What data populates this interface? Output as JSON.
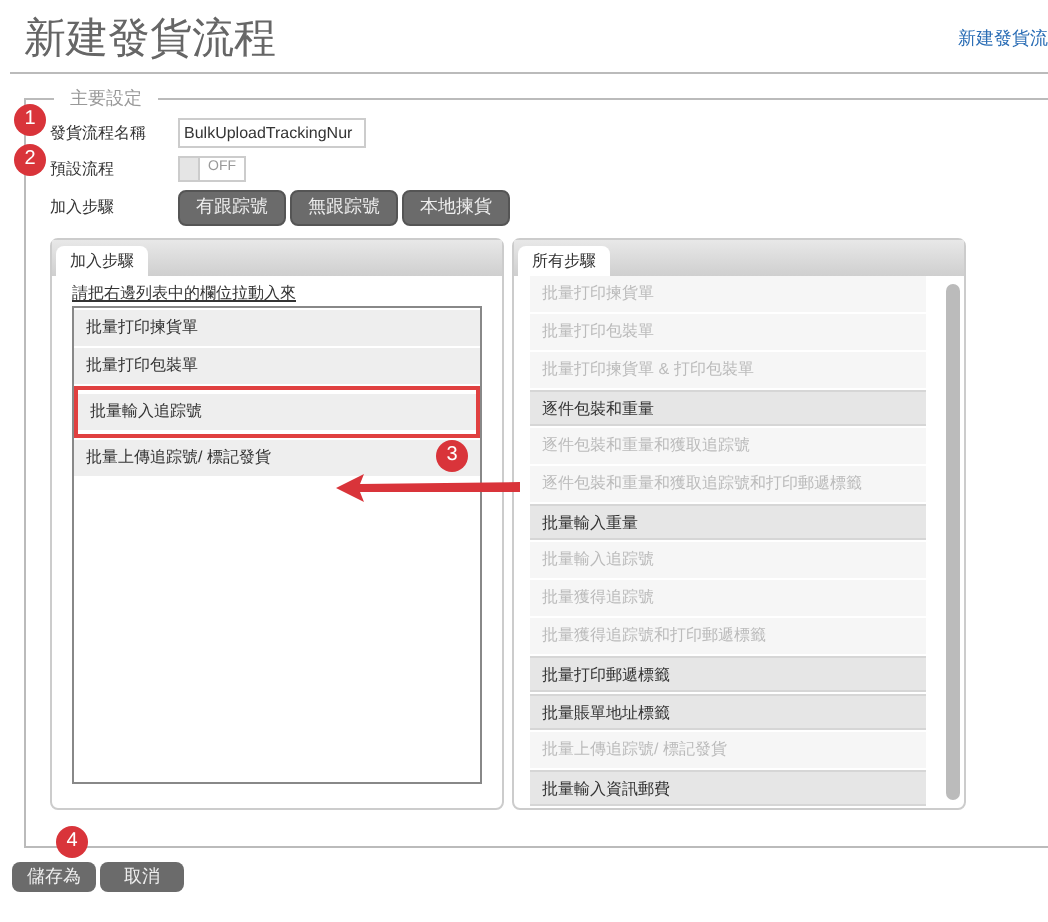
{
  "page": {
    "title": "新建發貨流程",
    "link": "新建發貨流"
  },
  "fieldset": {
    "legend": "主要設定"
  },
  "form": {
    "name_label": "發貨流程名稱",
    "name_value": "BulkUploadTrackingNur",
    "default_label": "預設流程",
    "default_switch": {
      "on": false,
      "label": "OFF"
    },
    "steps_label": "加入步驟",
    "step_buttons": [
      "有跟踪號",
      "無跟踪號",
      "本地揀貨"
    ]
  },
  "added_panel": {
    "tab": "加入步驟",
    "hint": "請把右邊列表中的欄位拉動入來",
    "items": [
      {
        "label": "批量打印揀貨單",
        "highlighted": false
      },
      {
        "label": "批量打印包裝單",
        "highlighted": false
      },
      {
        "label": "批量輸入追踪號",
        "highlighted": true
      },
      {
        "label": "批量上傳追踪號/ 標記發貨",
        "highlighted": false
      }
    ]
  },
  "all_panel": {
    "tab": "所有步驟",
    "items": [
      {
        "label": "批量打印揀貨單",
        "disabled": true
      },
      {
        "label": "批量打印包裝單",
        "disabled": true
      },
      {
        "label": "批量打印揀貨單 & 打印包裝單",
        "disabled": true
      },
      {
        "label": "逐件包裝和重量",
        "disabled": false
      },
      {
        "label": "逐件包裝和重量和獲取追踪號",
        "disabled": true
      },
      {
        "label": "逐件包裝和重量和獲取追踪號和打印郵遞標籤",
        "disabled": true
      },
      {
        "label": "批量輸入重量",
        "disabled": false
      },
      {
        "label": "批量輸入追踪號",
        "disabled": true
      },
      {
        "label": "批量獲得追踪號",
        "disabled": true
      },
      {
        "label": "批量獲得追踪號和打印郵遞標籤",
        "disabled": true
      },
      {
        "label": "批量打印郵遞標籤",
        "disabled": false
      },
      {
        "label": "批量賬單地址標籤",
        "disabled": false
      },
      {
        "label": "批量上傳追踪號/ 標記發貨",
        "disabled": true
      },
      {
        "label": "批量輸入資訊郵費",
        "disabled": false
      }
    ]
  },
  "actions": [
    "儲存為",
    "取消"
  ],
  "annotations": [
    "1",
    "2",
    "3",
    "4"
  ]
}
